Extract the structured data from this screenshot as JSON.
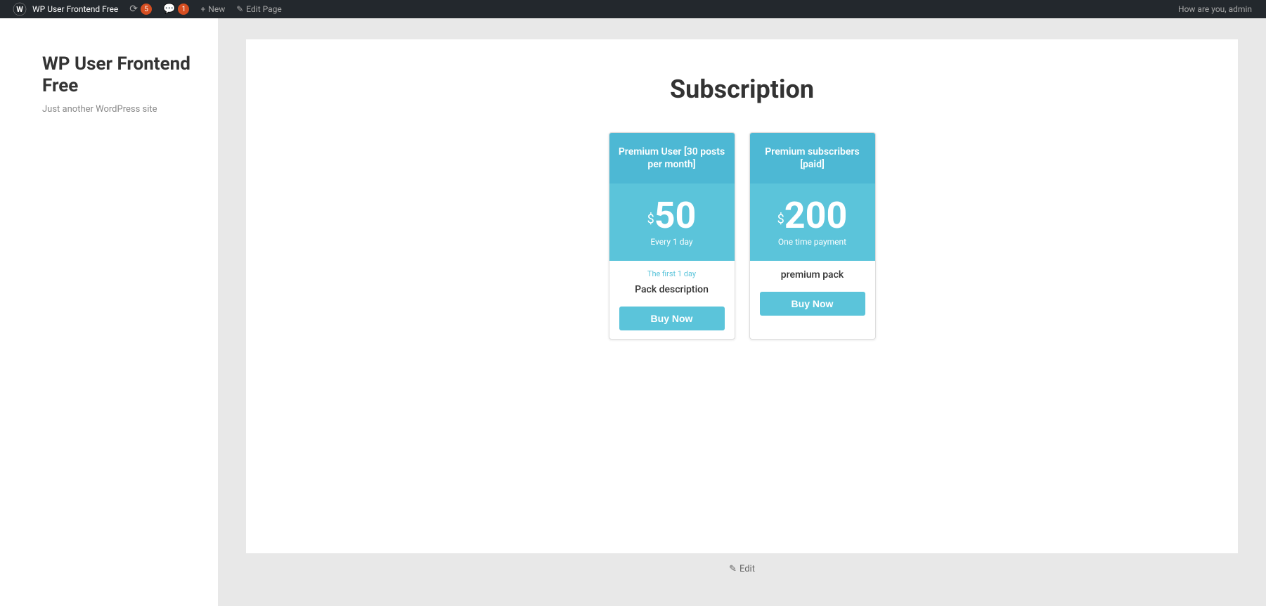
{
  "admin_bar": {
    "site_name": "WP User Frontend Free",
    "updates_count": "5",
    "comments_count": "1",
    "new_label": "New",
    "edit_page_label": "Edit Page",
    "greeting": "How are you, admin"
  },
  "sidebar": {
    "site_title": "WP User Frontend Free",
    "site_tagline": "Just another WordPress site"
  },
  "page": {
    "heading": "Subscription"
  },
  "cards": [
    {
      "id": "card-1",
      "header": "Premium User [30 posts per month]",
      "currency": "$",
      "amount": "50",
      "period": "Every 1 day",
      "trial": "The first 1 day",
      "description": "Pack description",
      "buy_label": "Buy Now"
    },
    {
      "id": "card-2",
      "header": "Premium subscribers [paid]",
      "currency": "$",
      "amount": "200",
      "period": "One time payment",
      "trial": "",
      "description": "premium pack",
      "buy_label": "Buy Now"
    }
  ],
  "footer": {
    "edit_label": "Edit"
  }
}
